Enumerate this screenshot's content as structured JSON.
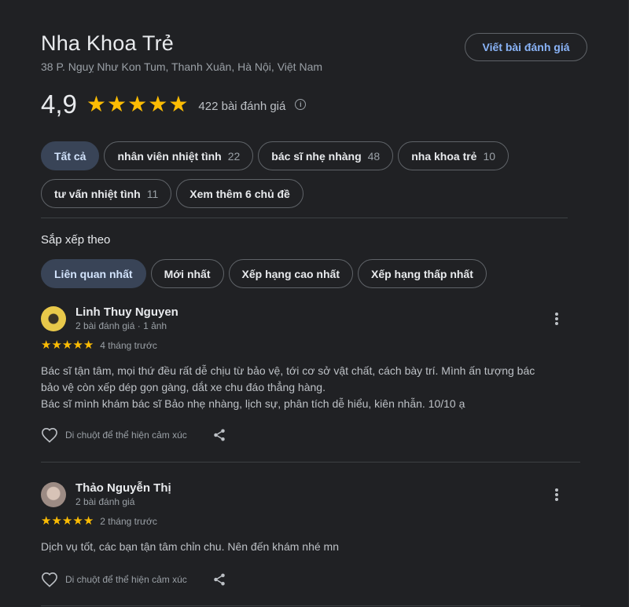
{
  "place": {
    "name": "Nha Khoa Trẻ",
    "address": "38 P. Nguỵ Như Kon Tum, Thanh Xuân, Hà Nội, Việt Nam",
    "write_review_label": "Viết bài đánh giá",
    "rating": "4,9",
    "stars": 5,
    "review_count": "422 bài đánh giá",
    "info_glyph": "i"
  },
  "topics": [
    {
      "label": "Tất cả",
      "count": "",
      "active": true
    },
    {
      "label": "nhân viên nhiệt tình",
      "count": "22",
      "active": false
    },
    {
      "label": "bác sĩ nhẹ nhàng",
      "count": "48",
      "active": false
    },
    {
      "label": "nha khoa trẻ",
      "count": "10",
      "active": false
    },
    {
      "label": "tư vấn nhiệt tình",
      "count": "11",
      "active": false
    },
    {
      "label": "Xem thêm 6 chủ đề",
      "count": "",
      "active": false
    }
  ],
  "sort": {
    "label": "Sắp xếp theo",
    "options": [
      {
        "label": "Liên quan nhất",
        "active": true
      },
      {
        "label": "Mới nhất",
        "active": false
      },
      {
        "label": "Xếp hạng cao nhất",
        "active": false
      },
      {
        "label": "Xếp hạng thấp nhất",
        "active": false
      }
    ]
  },
  "reviews": [
    {
      "name": "Linh Thuy Nguyen",
      "meta": "2 bài đánh giá · 1 ảnh",
      "stars": 5,
      "when": "4 tháng trước",
      "lines": [
        "Bác sĩ tận tâm, mọi thứ đều rất dễ chịu từ bảo vệ, tới cơ sở vật chất, cách bày trí. Mình ấn tượng bác",
        "bảo vệ còn xếp dép gọn gàng, dắt xe chu đáo thẳng hàng.",
        "Bác sĩ mình khám bác sĩ Bảo nhẹ nhàng, lịch sự, phân tích dễ hiểu, kiên nhẫn. 10/10 ạ"
      ],
      "react_label": "Di chuột để thể hiện cảm xúc"
    },
    {
      "name": "Thảo Nguyễn Thị",
      "meta": "2 bài đánh giá",
      "stars": 5,
      "when": "2 tháng trước",
      "lines": [
        "Dịch vụ tốt, các bạn tận tâm chỉn chu. Nên đến khám nhé mn"
      ],
      "react_label": "Di chuột để thể hiện cảm xúc"
    }
  ],
  "colors": {
    "background": "#202124",
    "star": "#fbbc04",
    "accent": "#8ab4f8",
    "active_chip": "#394457"
  },
  "icons": [
    "info-icon",
    "star-icon",
    "more-vert-icon",
    "heart-icon",
    "share-icon"
  ]
}
